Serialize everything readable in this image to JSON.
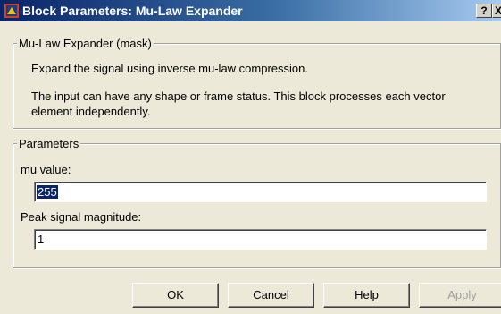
{
  "window": {
    "title": "Block Parameters: Mu-Law Expander",
    "help_button": "?",
    "close_button": "X"
  },
  "description": {
    "group_title": "Mu-Law Expander (mask)",
    "line1": "Expand the signal using inverse mu-law compression.",
    "line2": "The input can have any shape or frame status. This block processes each vector element independently."
  },
  "parameters": {
    "group_title": "Parameters",
    "mu_label": "mu value:",
    "mu_value": "255",
    "peak_label": "Peak signal magnitude:",
    "peak_value": "1"
  },
  "buttons": {
    "ok": "OK",
    "cancel": "Cancel",
    "help": "Help",
    "apply": "Apply"
  }
}
